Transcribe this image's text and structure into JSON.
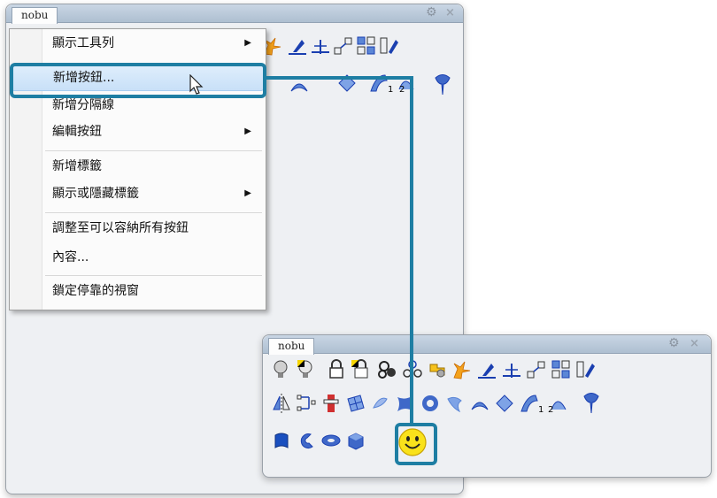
{
  "back_toolbar": {
    "tab_label": "nobu"
  },
  "front_toolbar": {
    "tab_label": "nobu"
  },
  "context_menu": {
    "items": [
      {
        "label": "顯示工具列",
        "submenu": true
      },
      {
        "label": "新增按鈕...",
        "submenu": false,
        "highlighted": true
      },
      {
        "label": "新增分隔線",
        "submenu": false
      },
      {
        "label": "編輯按鈕",
        "submenu": true
      },
      {
        "label": "新增標籤",
        "submenu": false
      },
      {
        "label": "顯示或隱藏標籤",
        "submenu": true
      },
      {
        "label": "調整至可以容納所有按鈕",
        "submenu": false
      },
      {
        "label": "內容...",
        "submenu": false
      },
      {
        "label": "鎖定停靠的視窗",
        "submenu": false
      }
    ]
  },
  "icons": {
    "gear": "gear-icon",
    "close": "close-icon",
    "submenu_arrow": "▶",
    "new_button": "smiley-icon"
  },
  "tool_labels": {
    "one": "1",
    "two": "2"
  },
  "colors": {
    "callout": "#1e7ea3",
    "menu_highlight": "#c8e0f8",
    "tab_bar": "#b9c9da"
  }
}
